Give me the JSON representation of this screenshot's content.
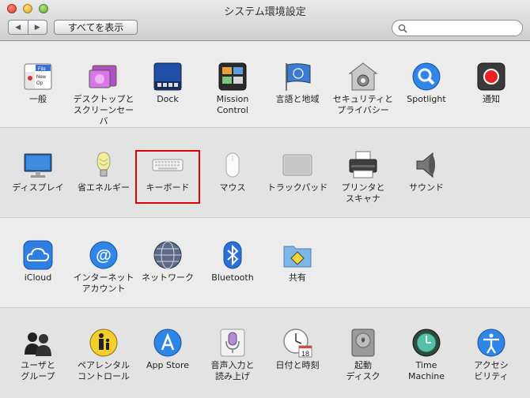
{
  "window": {
    "title": "システム環境設定"
  },
  "toolbar": {
    "back": "◀",
    "forward": "▶",
    "show_all": "すべてを表示",
    "search_placeholder": ""
  },
  "sections": [
    {
      "panes": [
        {
          "label": "一般",
          "icon": "general-icon"
        },
        {
          "label": "デスクトップと\nスクリーンセーバ",
          "icon": "desktop-screensaver-icon"
        },
        {
          "label": "Dock",
          "icon": "dock-icon"
        },
        {
          "label": "Mission\nControl",
          "icon": "mission-control-icon"
        },
        {
          "label": "言語と地域",
          "icon": "language-region-icon"
        },
        {
          "label": "セキュリティと\nプライバシー",
          "icon": "security-privacy-icon"
        },
        {
          "label": "Spotlight",
          "icon": "spotlight-icon"
        },
        {
          "label": "通知",
          "icon": "notifications-icon"
        }
      ]
    },
    {
      "panes": [
        {
          "label": "ディスプレイ",
          "icon": "displays-icon"
        },
        {
          "label": "省エネルギー",
          "icon": "energy-saver-icon"
        },
        {
          "label": "キーボード",
          "icon": "keyboard-icon"
        },
        {
          "label": "マウス",
          "icon": "mouse-icon"
        },
        {
          "label": "トラックパッド",
          "icon": "trackpad-icon"
        },
        {
          "label": "プリンタと\nスキャナ",
          "icon": "printers-scanners-icon"
        },
        {
          "label": "サウンド",
          "icon": "sound-icon"
        }
      ]
    },
    {
      "panes": [
        {
          "label": "iCloud",
          "icon": "icloud-icon"
        },
        {
          "label": "インターネット\nアカウント",
          "icon": "internet-accounts-icon"
        },
        {
          "label": "ネットワーク",
          "icon": "network-icon"
        },
        {
          "label": "Bluetooth",
          "icon": "bluetooth-icon"
        },
        {
          "label": "共有",
          "icon": "sharing-icon"
        }
      ]
    },
    {
      "panes": [
        {
          "label": "ユーザと\nグループ",
          "icon": "users-groups-icon"
        },
        {
          "label": "ペアレンタル\nコントロール",
          "icon": "parental-controls-icon"
        },
        {
          "label": "App Store",
          "icon": "app-store-icon"
        },
        {
          "label": "音声入力と\n読み上げ",
          "icon": "dictation-speech-icon"
        },
        {
          "label": "日付と時刻",
          "icon": "date-time-icon"
        },
        {
          "label": "起動\nディスク",
          "icon": "startup-disk-icon"
        },
        {
          "label": "Time\nMachine",
          "icon": "time-machine-icon"
        },
        {
          "label": "アクセシ\nビリティ",
          "icon": "accessibility-icon"
        }
      ]
    }
  ],
  "date_icon_day": "18",
  "highlight_color": "#e00000"
}
